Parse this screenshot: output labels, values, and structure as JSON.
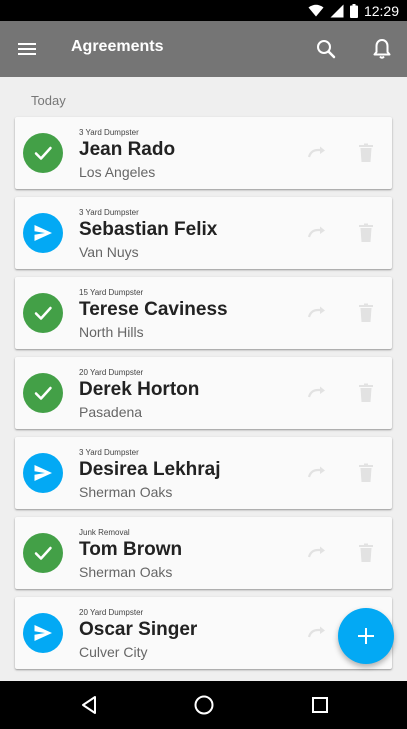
{
  "status_bar": {
    "time": "12:29",
    "icons": [
      "wifi-icon",
      "signal-icon",
      "battery-icon"
    ]
  },
  "app_bar": {
    "title": "Agreements",
    "icons": [
      "menu-icon",
      "search-icon",
      "bell-icon"
    ]
  },
  "section": {
    "label": "Today"
  },
  "agreements": [
    {
      "service": "3 Yard Dumpster",
      "name": "Jean Rado",
      "city": "Los Angeles",
      "status": "completed"
    },
    {
      "service": "3 Yard Dumpster",
      "name": "Sebastian Felix",
      "city": "Van Nuys",
      "status": "sent"
    },
    {
      "service": "15 Yard Dumpster",
      "name": "Terese Caviness",
      "city": "North Hills",
      "status": "completed"
    },
    {
      "service": "20 Yard Dumpster",
      "name": "Derek Horton",
      "city": "Pasadena",
      "status": "completed"
    },
    {
      "service": "3 Yard Dumpster",
      "name": "Desirea Lekhraj",
      "city": "Sherman Oaks",
      "status": "sent"
    },
    {
      "service": "Junk Removal",
      "name": "Tom Brown",
      "city": "Sherman Oaks",
      "status": "completed"
    },
    {
      "service": "20 Yard Dumpster",
      "name": "Oscar Singer",
      "city": "Culver City",
      "status": "sent"
    }
  ],
  "fab": {
    "icon": "plus-icon"
  },
  "colors": {
    "app_bar": "#757575",
    "completed": "#43a047",
    "sent": "#03a9f4",
    "fab": "#03a9f4"
  }
}
